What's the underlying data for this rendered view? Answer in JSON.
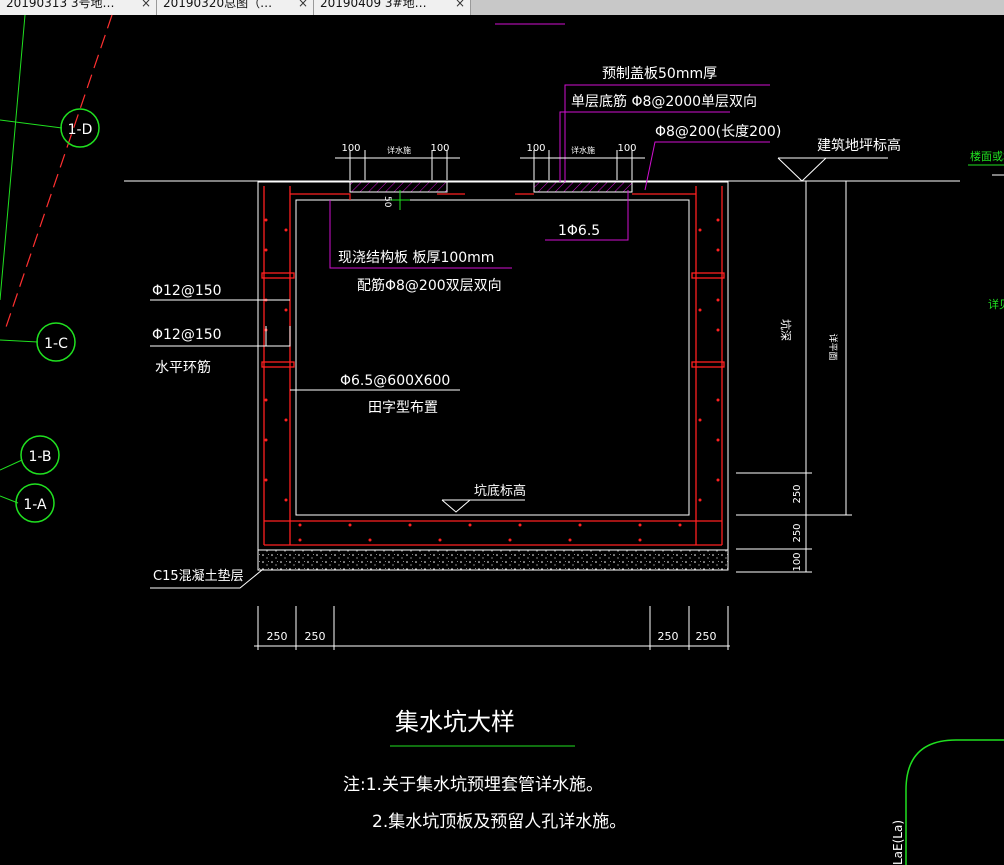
{
  "tabs": [
    {
      "label": "20190313 3号地…",
      "close": "×"
    },
    {
      "label": "20190320总图（…",
      "close": "×"
    },
    {
      "label": "20190409 3#地…",
      "close": "×"
    }
  ],
  "grid_axes": {
    "d": "1-D",
    "c": "1-C",
    "b": "1-B",
    "a": "1-A"
  },
  "annotations": {
    "cover_slab": "预制盖板50mm厚",
    "single_rebar": "单层底筋 Φ8@2000单层双向",
    "phi8_200": "Φ8@200(长度200)",
    "floor_level": "建筑地坪标高",
    "phi65": "1Φ6.5",
    "castslab_1": "现浇结构板 板厚100mm",
    "castslab_2": "配筋Φ8@200双层双向",
    "phi12_a": "Φ12@150",
    "phi12_b": "Φ12@150",
    "horiz_ring": "水平环筋",
    "phi65_grid": "Φ6.5@600X600",
    "tian_layout": "田字型布置",
    "pit_bottom": "坑底标高",
    "c15_layer": "C15混凝土垫层",
    "opening_a": "详水施",
    "opening_b": "详水施",
    "pit_depth": "坑深",
    "see_plan": "详平面",
    "right_label_1": "楼面或地",
    "right_label_2": "详见",
    "corner_text": "LaE(La)",
    "small_50": "50"
  },
  "dims": {
    "top": [
      "100",
      "100",
      "100",
      "100"
    ],
    "vertical": [
      "250",
      "250",
      "100"
    ],
    "bottom": [
      "250",
      "250",
      "250",
      "250"
    ]
  },
  "title": "集水坑大样",
  "notes": [
    "注:1.关于集水坑预埋套管详水施。",
    "2.集水坑顶板及预留人孔详水施。"
  ],
  "colors": {
    "background": "#000000",
    "line": "#ffffff",
    "rebar": "#ff2020",
    "leader": "#d010d0",
    "grid": "#20e020",
    "axis_dash": "#ff3030"
  }
}
